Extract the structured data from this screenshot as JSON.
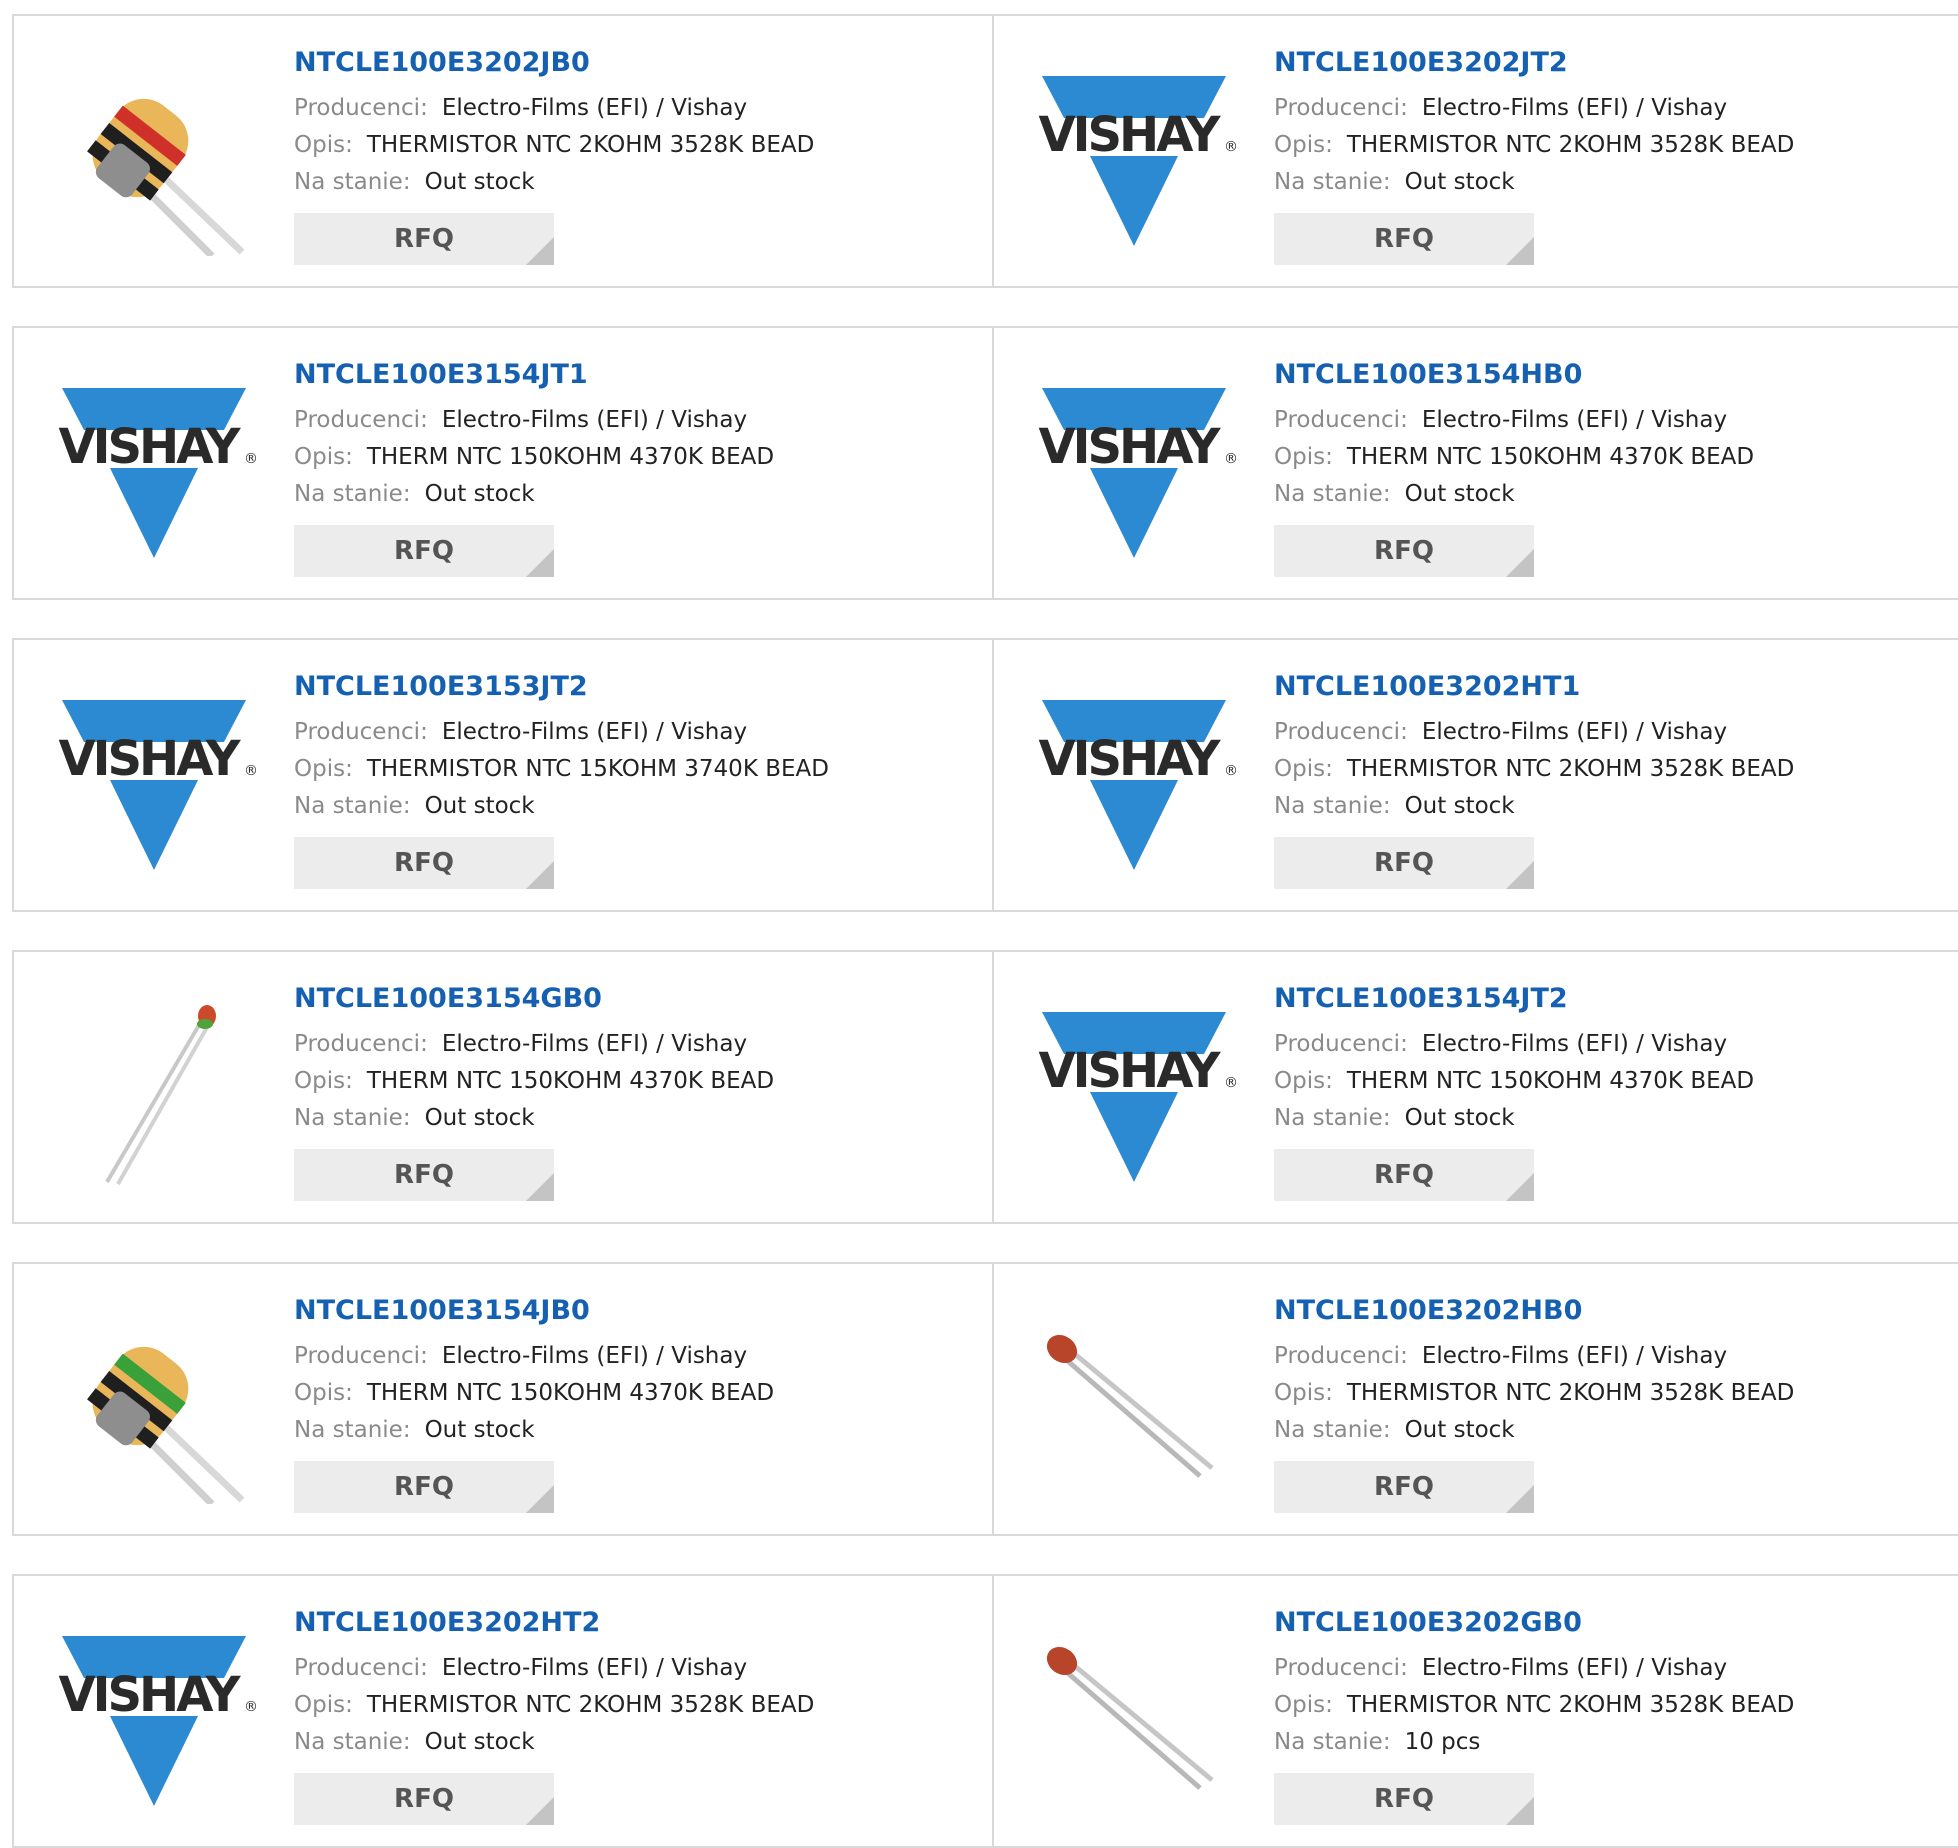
{
  "labels": {
    "manufacturer": "Producenci:",
    "description": "Opis:",
    "stock": "Na stanie:",
    "rfq": "RFQ"
  },
  "logo": {
    "text": "VISHAY",
    "mark": "®",
    "color": "#2b8ad1"
  },
  "colors": {
    "link": "#1560b0",
    "border": "#d9d9d9",
    "button": "#ececec"
  },
  "products": [
    {
      "pn": "NTCLE100E3202JB0",
      "manufacturer": "Electro-Films (EFI) / Vishay",
      "description": "THERMISTOR NTC 2KOHM 3528K BEAD",
      "stock": "Out stock",
      "thumb": "bead-red-photo"
    },
    {
      "pn": "NTCLE100E3202JT2",
      "manufacturer": "Electro-Films (EFI) / Vishay",
      "description": "THERMISTOR NTC 2KOHM 3528K BEAD",
      "stock": "Out stock",
      "thumb": "vishay-logo"
    },
    {
      "pn": "NTCLE100E3154JT1",
      "manufacturer": "Electro-Films (EFI) / Vishay",
      "description": "THERM NTC 150KOHM 4370K BEAD",
      "stock": "Out stock",
      "thumb": "vishay-logo"
    },
    {
      "pn": "NTCLE100E3154HB0",
      "manufacturer": "Electro-Films (EFI) / Vishay",
      "description": "THERM NTC 150KOHM 4370K BEAD",
      "stock": "Out stock",
      "thumb": "vishay-logo"
    },
    {
      "pn": "NTCLE100E3153JT2",
      "manufacturer": "Electro-Films (EFI) / Vishay",
      "description": "THERMISTOR NTC 15KOHM 3740K BEAD",
      "stock": "Out stock",
      "thumb": "vishay-logo"
    },
    {
      "pn": "NTCLE100E3202HT1",
      "manufacturer": "Electro-Films (EFI) / Vishay",
      "description": "THERMISTOR NTC 2KOHM 3528K BEAD",
      "stock": "Out stock",
      "thumb": "vishay-logo"
    },
    {
      "pn": "NTCLE100E3154GB0",
      "manufacturer": "Electro-Films (EFI) / Vishay",
      "description": "THERM NTC 150KOHM 4370K BEAD",
      "stock": "Out stock",
      "thumb": "small-bead-photo"
    },
    {
      "pn": "NTCLE100E3154JT2",
      "manufacturer": "Electro-Films (EFI) / Vishay",
      "description": "THERM NTC 150KOHM 4370K BEAD",
      "stock": "Out stock",
      "thumb": "vishay-logo"
    },
    {
      "pn": "NTCLE100E3154JB0",
      "manufacturer": "Electro-Films (EFI) / Vishay",
      "description": "THERM NTC 150KOHM 4370K BEAD",
      "stock": "Out stock",
      "thumb": "bead-green-photo"
    },
    {
      "pn": "NTCLE100E3202HB0",
      "manufacturer": "Electro-Films (EFI) / Vishay",
      "description": "THERMISTOR NTC 2KOHM 3528K BEAD",
      "stock": "Out stock",
      "thumb": "leaded-thermistor-photo"
    },
    {
      "pn": "NTCLE100E3202HT2",
      "manufacturer": "Electro-Films (EFI) / Vishay",
      "description": "THERMISTOR NTC 2KOHM 3528K BEAD",
      "stock": "Out stock",
      "thumb": "vishay-logo"
    },
    {
      "pn": "NTCLE100E3202GB0",
      "manufacturer": "Electro-Films (EFI) / Vishay",
      "description": "THERMISTOR NTC 2KOHM 3528K BEAD",
      "stock": "10 pcs",
      "thumb": "leaded-thermistor-photo"
    }
  ]
}
